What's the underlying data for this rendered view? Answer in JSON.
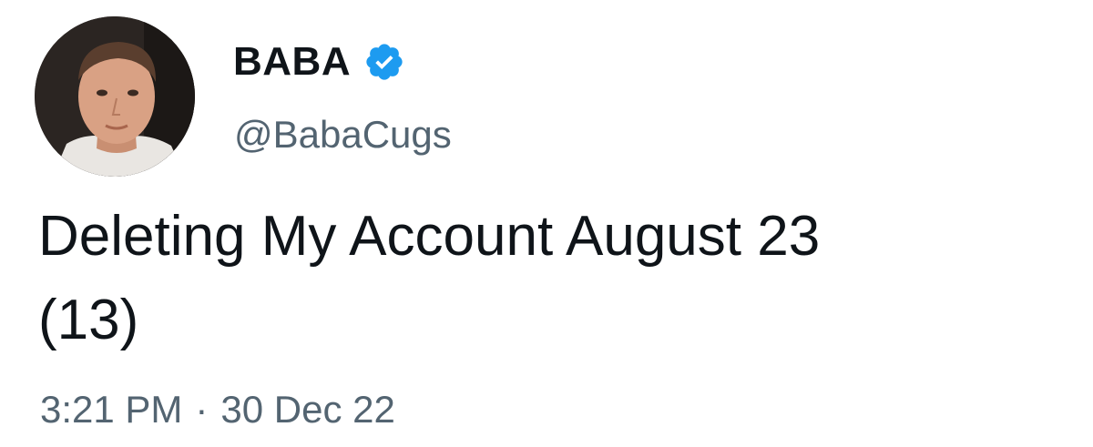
{
  "tweet": {
    "author": {
      "display_name": "BABA",
      "handle": "@BabaCugs",
      "verified": true,
      "avatar_icon": "profile-photo"
    },
    "text": "Deleting My Account August 23\n(13)",
    "time": "3:21 PM",
    "separator": "·",
    "date": "30 Dec 22"
  },
  "colors": {
    "text": "#0f1419",
    "secondary": "#536471",
    "verified_blue": "#1d9bf0"
  }
}
